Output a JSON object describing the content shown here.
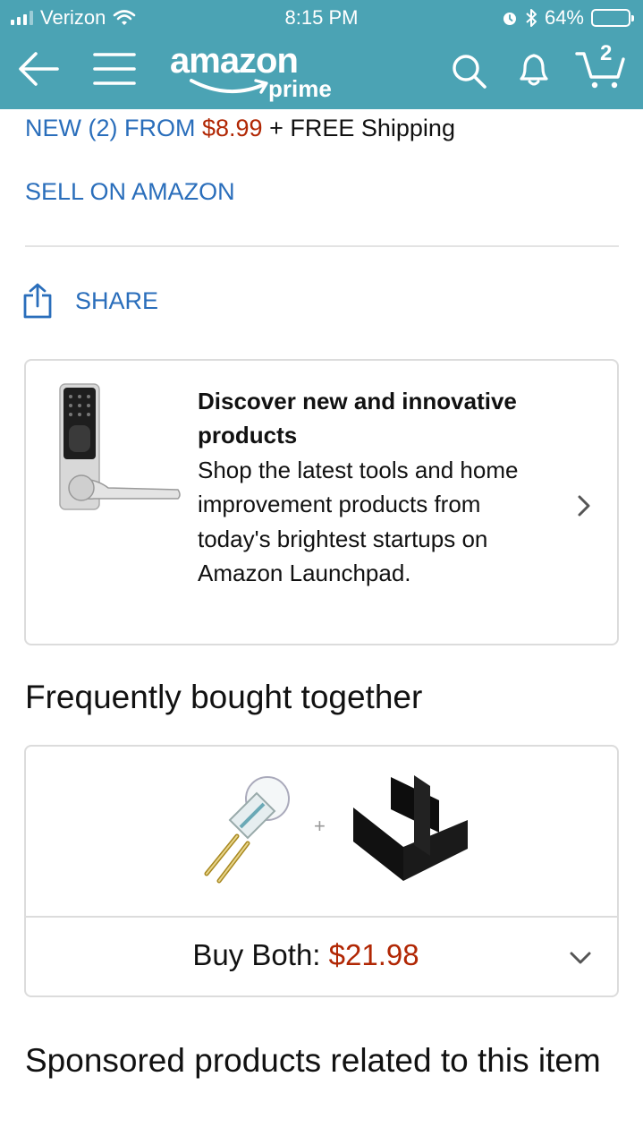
{
  "status_bar": {
    "carrier": "Verizon",
    "time": "8:15 PM",
    "battery": "64%",
    "battery_level": 0.64,
    "icons": [
      "signal-icon",
      "wifi-icon",
      "alarm-icon",
      "bluetooth-icon",
      "battery-icon"
    ]
  },
  "nav": {
    "logo_word": "amazon",
    "logo_prime": "prime",
    "cart_count": "2",
    "icons": [
      "back-arrow-icon",
      "menu-icon",
      "search-icon",
      "bell-icon",
      "cart-icon"
    ]
  },
  "offer": {
    "new_from_label": "NEW (2) FROM",
    "new_from_price": "$8.99",
    "shipping": "+ FREE Shipping",
    "sell_link": "SELL ON AMAZON"
  },
  "share": {
    "label": "SHARE",
    "icon": "share-icon"
  },
  "promo": {
    "title": "Discover new and innovative products",
    "body": "Shop the latest tools and home improvement products from today's brightest startups on Amazon Launchpad.",
    "image": "smart-lock-image"
  },
  "frequently_bought": {
    "heading": "Frequently bought together",
    "plus": "+",
    "buy_label": "Buy Both:",
    "buy_price": "$21.98",
    "images": [
      "halogen-bulb-image",
      "drawer-divider-image"
    ]
  },
  "sponsored": {
    "heading": "Sponsored products related to this item"
  },
  "colors": {
    "nav_teal": "#4ba3b4",
    "link_blue": "#2a6ebb",
    "price_red": "#b12704"
  }
}
